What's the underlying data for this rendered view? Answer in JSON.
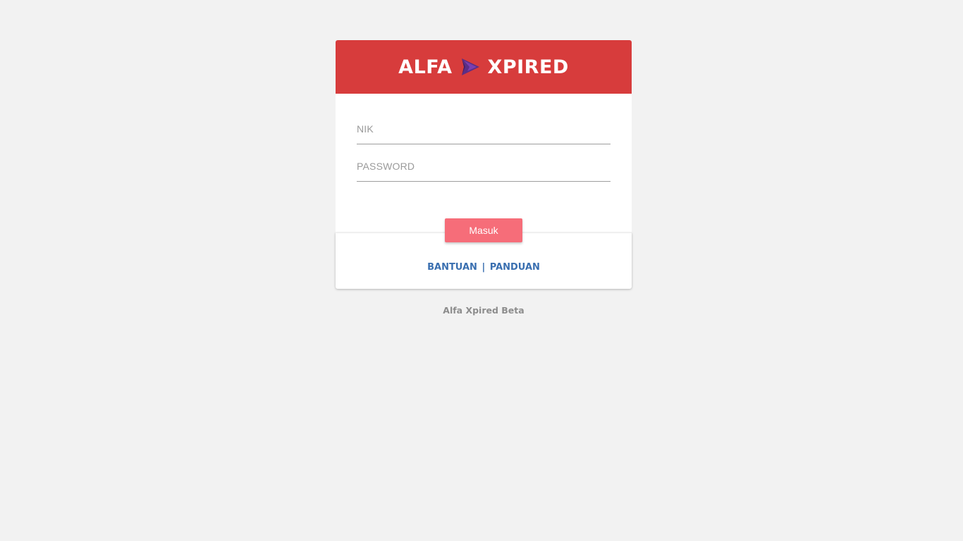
{
  "header": {
    "brand_left": "ALFA",
    "brand_right": "XPIRED",
    "logo_icon": "chevron-right-icon",
    "background_color": "#d73c3c"
  },
  "form": {
    "nik_placeholder": "NIK",
    "nik_value": "",
    "password_placeholder": "PASSWORD",
    "password_value": "",
    "submit_label": "Masuk",
    "submit_color": "#f66d79"
  },
  "links": {
    "help_label": "BANTUAN",
    "separator": "|",
    "guide_label": "PANDUAN",
    "link_color": "#3a6fb0"
  },
  "footer": {
    "text": "Alfa Xpired Beta"
  }
}
